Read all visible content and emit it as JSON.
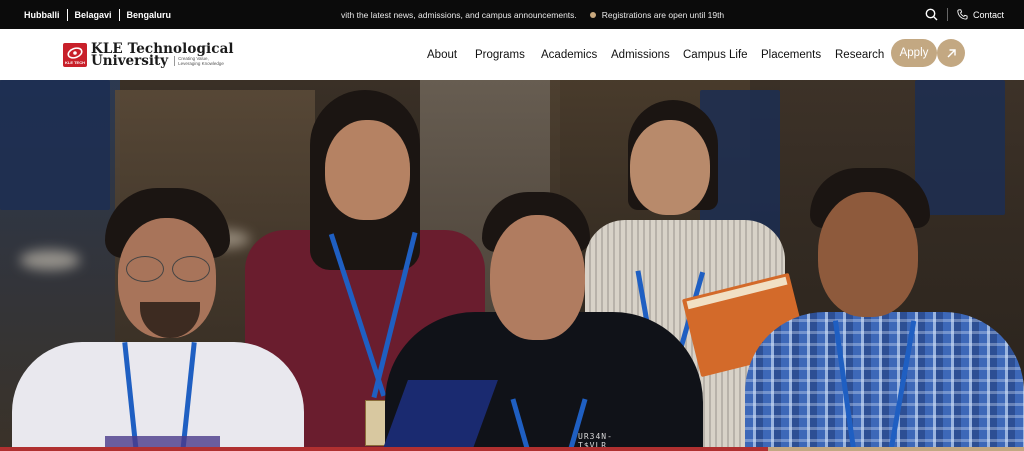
{
  "topbar": {
    "campuses": [
      "Hubballi",
      "Belagavi",
      "Bengaluru"
    ],
    "ticker_text": "vith the latest news, admissions, and campus announcements.",
    "ticker_alert": "Registrations are open until 19th",
    "contact_label": "Contact"
  },
  "brand": {
    "name_line1": "KLE Technological",
    "name_line2": "University",
    "tagline": "Creating Value, Leveraging Knowledge",
    "mark_text": "KLE TECH"
  },
  "nav": {
    "items": [
      "About",
      "Programs",
      "Academics",
      "Admissions",
      "Campus Life",
      "Placements",
      "Research"
    ],
    "apply_label": "Apply"
  },
  "hero": {
    "shirt_text": "UR34N-T$VLR"
  },
  "colors": {
    "topbar_bg": "#0b0b0b",
    "accent_gold": "#c3a882",
    "brand_red": "#c8202a",
    "alert_dot": "#c9a97e"
  }
}
